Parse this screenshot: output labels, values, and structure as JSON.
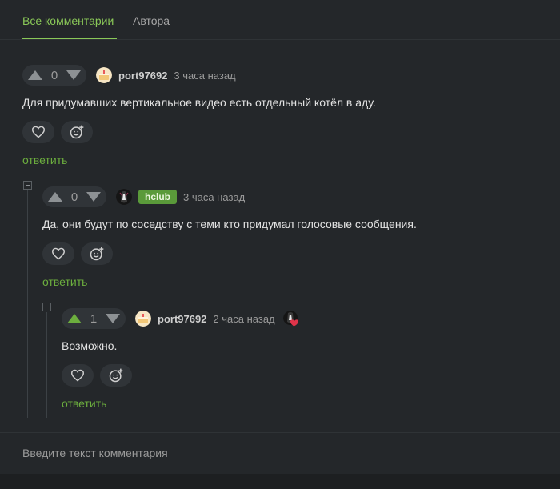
{
  "tabs": {
    "all_comments": "Все комментарии",
    "author": "Автора"
  },
  "comments": [
    {
      "votes": "0",
      "username": "port97692",
      "time": "3 часа назад",
      "text": "Для придумавших вертикальное видео есть отдельный котёл в аду.",
      "reply_label": "ответить"
    },
    {
      "votes": "0",
      "username": "hclub",
      "time": "3 часа назад",
      "text": "Да, они будут по соседству с теми кто придумал голосовые сообщения.",
      "reply_label": "ответить"
    },
    {
      "votes": "1",
      "username": "port97692",
      "time": "2 часа назад",
      "text": "Возможно.",
      "reply_label": "ответить"
    }
  ],
  "input": {
    "placeholder": "Введите текст комментария"
  },
  "colors": {
    "accent": "#8ac858",
    "reply": "#6cae3e",
    "upvoted": "#6cae3e",
    "badge": "#5a9a3a"
  }
}
